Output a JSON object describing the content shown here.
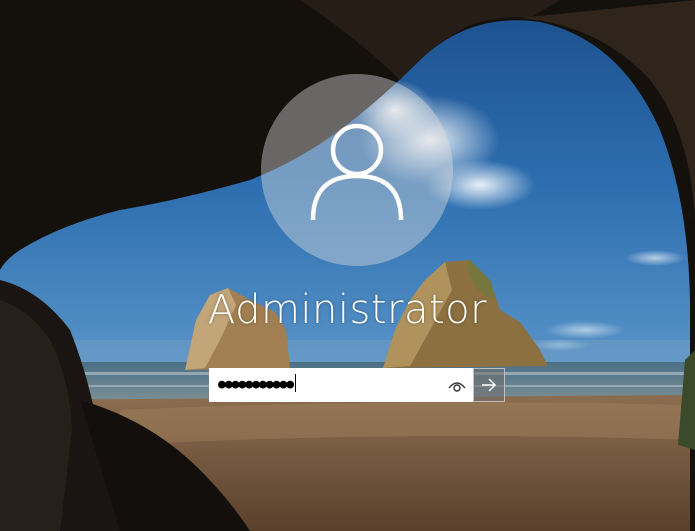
{
  "login": {
    "username": "Administrator",
    "password_mask": "●●●●●●●●●●●",
    "password_length": 11
  },
  "icons": {
    "avatar": "user-icon",
    "reveal": "eye-icon",
    "submit": "arrow-right-icon"
  },
  "colors": {
    "sky": "#2a67a8",
    "avatar_circle": "#e1e1e1",
    "text": "#ffffff",
    "input_bg": "#ffffff"
  }
}
